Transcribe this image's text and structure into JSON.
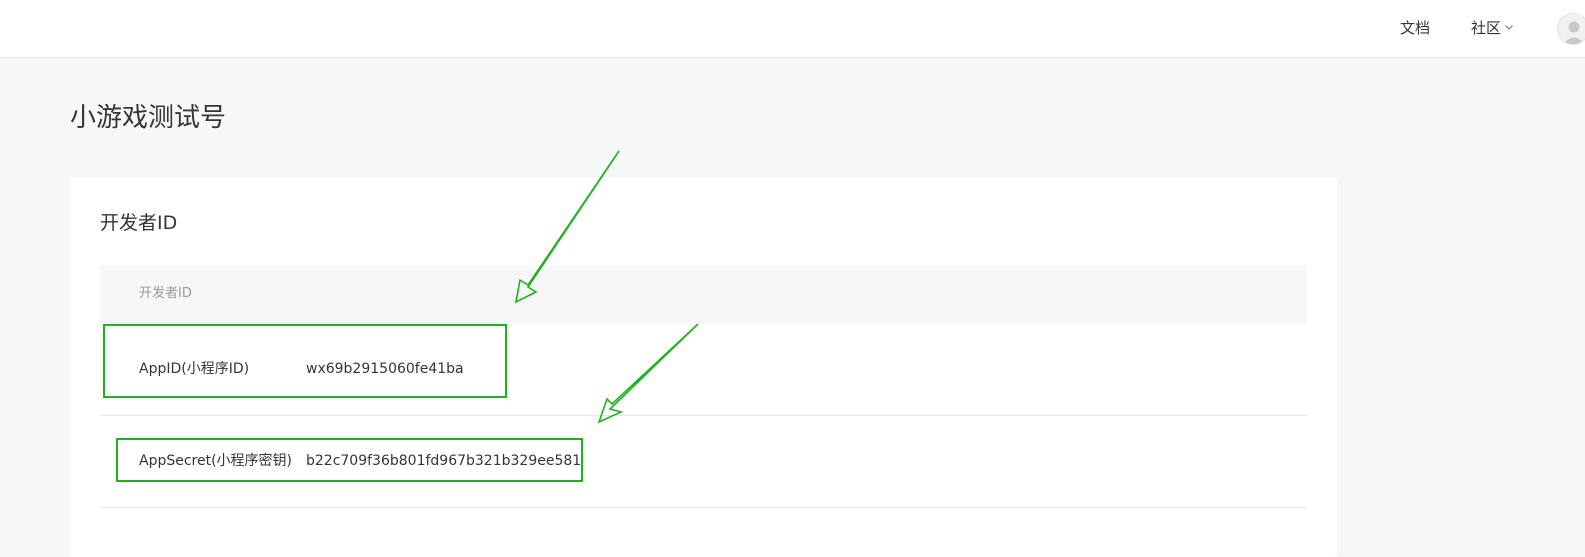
{
  "nav": {
    "docs": "文档",
    "community": "社区",
    "community_icon": "chevron-down-icon",
    "avatar_icon": "user-avatar-icon"
  },
  "page": {
    "title": "小游戏测试号"
  },
  "card": {
    "title": "开发者ID",
    "table_header": "开发者ID",
    "rows": [
      {
        "label": "AppID(小程序ID)",
        "value": "wx69b2915060fe41ba"
      },
      {
        "label": "AppSecret(小程序密钥)",
        "value": "b22c709f36b801fd967b321b329ee581"
      }
    ]
  },
  "colors": {
    "annotation": "#22b022",
    "background": "#f6f7f9",
    "card": "#ffffff",
    "text": "#353535",
    "muted": "#9a9a9a"
  }
}
